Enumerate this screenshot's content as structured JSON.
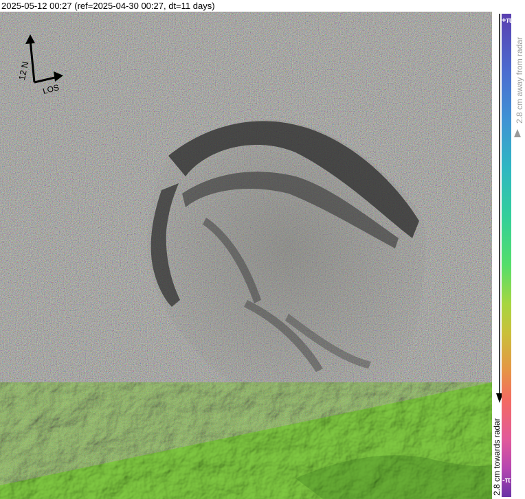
{
  "title": "2025-05-12 00:27 (ref=2025-04-30 00:27, dt=11 days)",
  "orientation": {
    "north_label": "12 N",
    "los_label": "LOS"
  },
  "colorbar": {
    "top_label": "+π",
    "bottom_label": "-π",
    "away_label": "2.8 cm away from radar",
    "towards_label": "2.8 cm towards radar"
  },
  "colors": {
    "terrain_green": "#6fbf3a",
    "interferogram_gray": "#8a8a84",
    "scar_dark": "#2a2a2a"
  }
}
